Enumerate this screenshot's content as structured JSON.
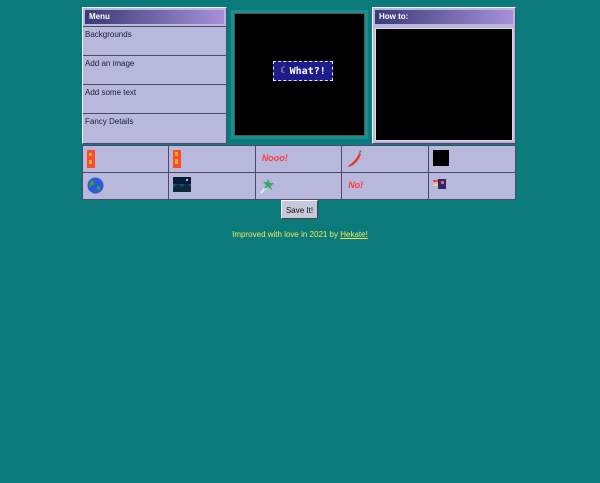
{
  "menu": {
    "title": "Menu",
    "items": [
      {
        "label": "Backgrounds"
      },
      {
        "label": "Add an image"
      },
      {
        "label": "Add some text"
      },
      {
        "label": "Fancy Details"
      }
    ]
  },
  "preview": {
    "badge_text": "What?!"
  },
  "howto": {
    "title": "How to:"
  },
  "gallery": {
    "row1": [
      {
        "icon": "red-banner-icon"
      },
      {
        "icon": "red-banner-icon"
      },
      {
        "icon": "word-art",
        "text": "Nooo!"
      },
      {
        "icon": "red-chili-icon"
      },
      {
        "icon": "black-square-icon"
      }
    ],
    "row2": [
      {
        "icon": "globe-icon"
      },
      {
        "icon": "night-landscape-icon"
      },
      {
        "icon": "shooting-star-icon"
      },
      {
        "icon": "word-art",
        "text": "No!"
      },
      {
        "icon": "fast-runner-icon"
      }
    ]
  },
  "actions": {
    "save_label": "Save It!"
  },
  "footer": {
    "prefix": "Improved with love in 2021 by ",
    "author": "Hekate!"
  },
  "colors": {
    "background": "#0b7a7a",
    "panel": "#b8b8dc",
    "titlebar_start": "#3a3a78",
    "titlebar_end": "#a890d8",
    "footer_text": "#f2e85a"
  }
}
